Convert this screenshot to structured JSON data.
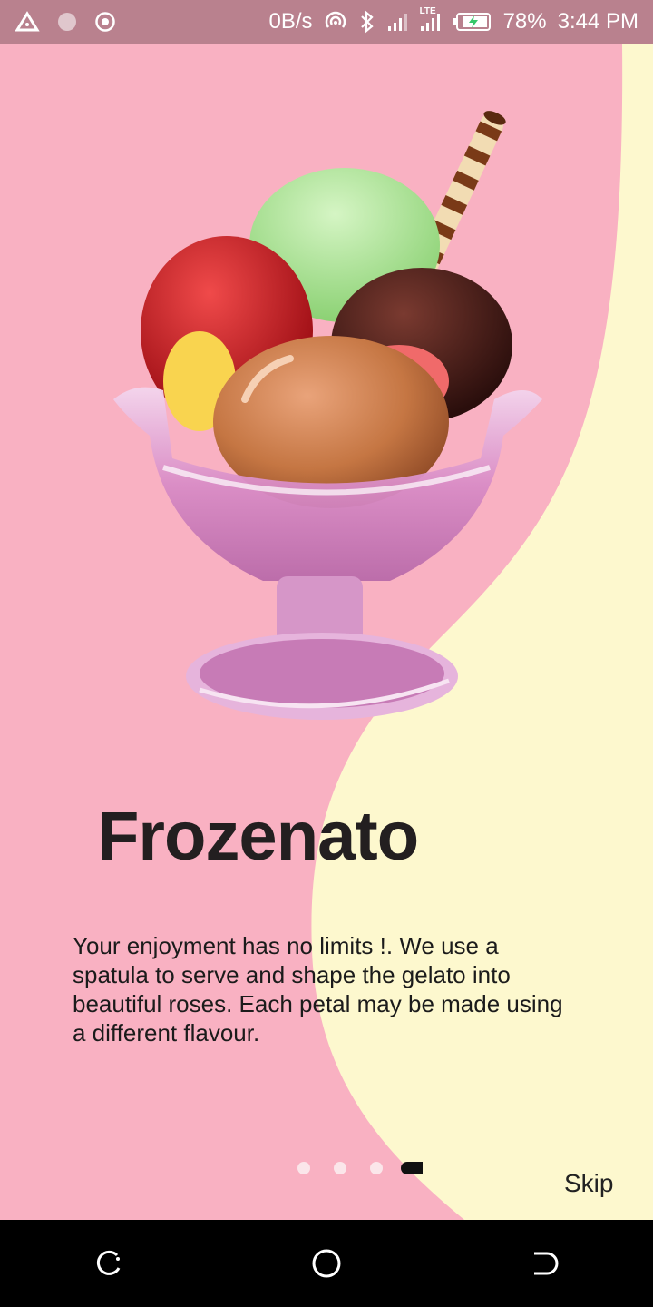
{
  "status_bar": {
    "speed": "0B/s",
    "battery": "78%",
    "time": "3:44 PM",
    "network_tag": "LTE",
    "left_icons": [
      "delta-icon",
      "blurred-dot-icon",
      "target-circle-icon"
    ],
    "right_icons": [
      "hotspot-icon",
      "bluetooth-icon",
      "signal-icon",
      "lte-signal-icon",
      "battery-charging-icon"
    ]
  },
  "onboarding": {
    "title": "Frozenato",
    "description": "Your enjoyment has no limits !. We use a spatula to serve and shape the gelato into beautiful roses. Each petal may be made using a different flavour.",
    "skip_label": "Skip",
    "pages_total": 4,
    "active_page": 4
  },
  "nav_bar": {
    "icons": [
      "recent-apps-icon",
      "home-icon",
      "back-icon"
    ]
  },
  "colors": {
    "pink_bg": "#f9b1c2",
    "cream_wave": "#fdf8ce",
    "status_bar": "#b9818e",
    "title_text": "#231f20"
  }
}
